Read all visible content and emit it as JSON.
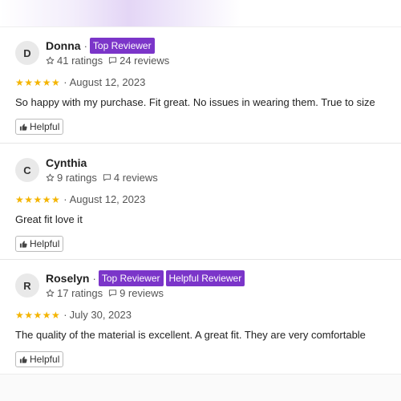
{
  "reviews": [
    {
      "initial": "D",
      "name": "Donna",
      "badges": [
        "Top Reviewer"
      ],
      "ratings_text": "41 ratings",
      "reviews_text": "24 reviews",
      "stars": "★★★★★",
      "date": "August 12, 2023",
      "text": "So happy with my purchase. Fit great. No issues in wearing them. True to size",
      "helpful_label": "Helpful"
    },
    {
      "initial": "C",
      "name": "Cynthia",
      "badges": [],
      "ratings_text": "9 ratings",
      "reviews_text": "4 reviews",
      "stars": "★★★★★",
      "date": "August 12, 2023",
      "text": "Great fit love it",
      "helpful_label": "Helpful"
    },
    {
      "initial": "R",
      "name": "Roselyn",
      "badges": [
        "Top Reviewer",
        "Helpful Reviewer"
      ],
      "ratings_text": "17 ratings",
      "reviews_text": "9 reviews",
      "stars": "★★★★★",
      "date": "July 30, 2023",
      "text": "The quality of the material is excellent. A great fit. They are very comfortable",
      "helpful_label": "Helpful"
    }
  ],
  "separator": "·",
  "colors": {
    "badge": "#7b35c9",
    "star": "#f4b400"
  },
  "icons": {
    "ratings": "star-outline-icon",
    "reviews": "comment-icon",
    "helpful": "thumbs-up-icon"
  }
}
